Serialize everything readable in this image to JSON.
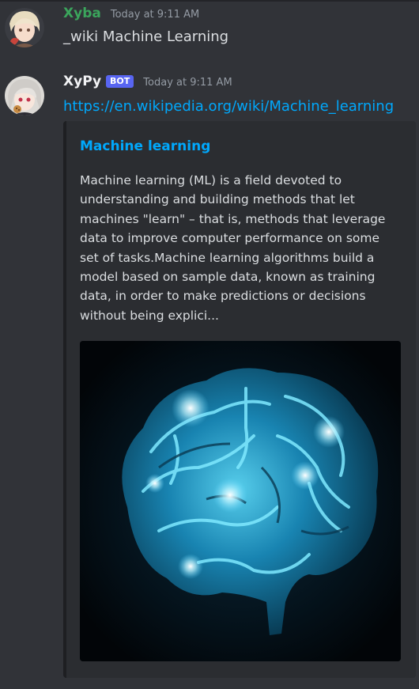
{
  "messages": [
    {
      "username": "Xyba",
      "username_color": "#3ba55c",
      "timestamp": "Today at 9:11 AM",
      "text": "_wiki Machine Learning"
    },
    {
      "username": "XyPy",
      "username_color": "#f2f3f5",
      "bot_tag": "BOT",
      "timestamp": "Today at 9:11 AM",
      "link_text": "https://en.wikipedia.org/wiki/Machine_learning",
      "embed": {
        "title": "Machine learning",
        "description_lines": [
          "Machine learning (ML) is a field devoted to",
          "understanding and building methods that let",
          "machines \"learn\" – that is, methods that leverage",
          "data to improve computer performance on some",
          "set of tasks.Machine learning algorithms build a",
          "model based on sample data, known as training",
          "data, in order to make predictions or decisions",
          "without being explici..."
        ],
        "image_icon": "glowing-brain-image"
      }
    }
  ],
  "colors": {
    "background": "#313338",
    "embed_background": "#2b2d31",
    "link": "#00a8fc",
    "bot_tag": "#5865f2"
  }
}
